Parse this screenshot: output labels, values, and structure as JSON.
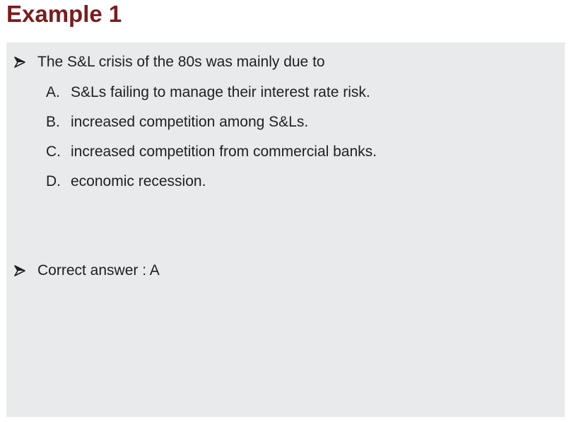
{
  "title": "Example 1",
  "question": {
    "text": "The S&L crisis of the 80s was mainly due to",
    "options": [
      {
        "letter": "A.",
        "text": "S&Ls failing to manage their interest rate risk."
      },
      {
        "letter": "B.",
        "text": "increased competition among S&Ls."
      },
      {
        "letter": "C.",
        "text": "increased competition from commercial banks."
      },
      {
        "letter": "D.",
        "text": "economic recession."
      }
    ]
  },
  "answer": {
    "text": "Correct answer : A"
  },
  "colors": {
    "title": "#7b1c1c",
    "panel_background": "#e9eaeb",
    "text": "#1f1f1f"
  },
  "icons": {
    "bullet": "arrow-bullet-icon"
  }
}
